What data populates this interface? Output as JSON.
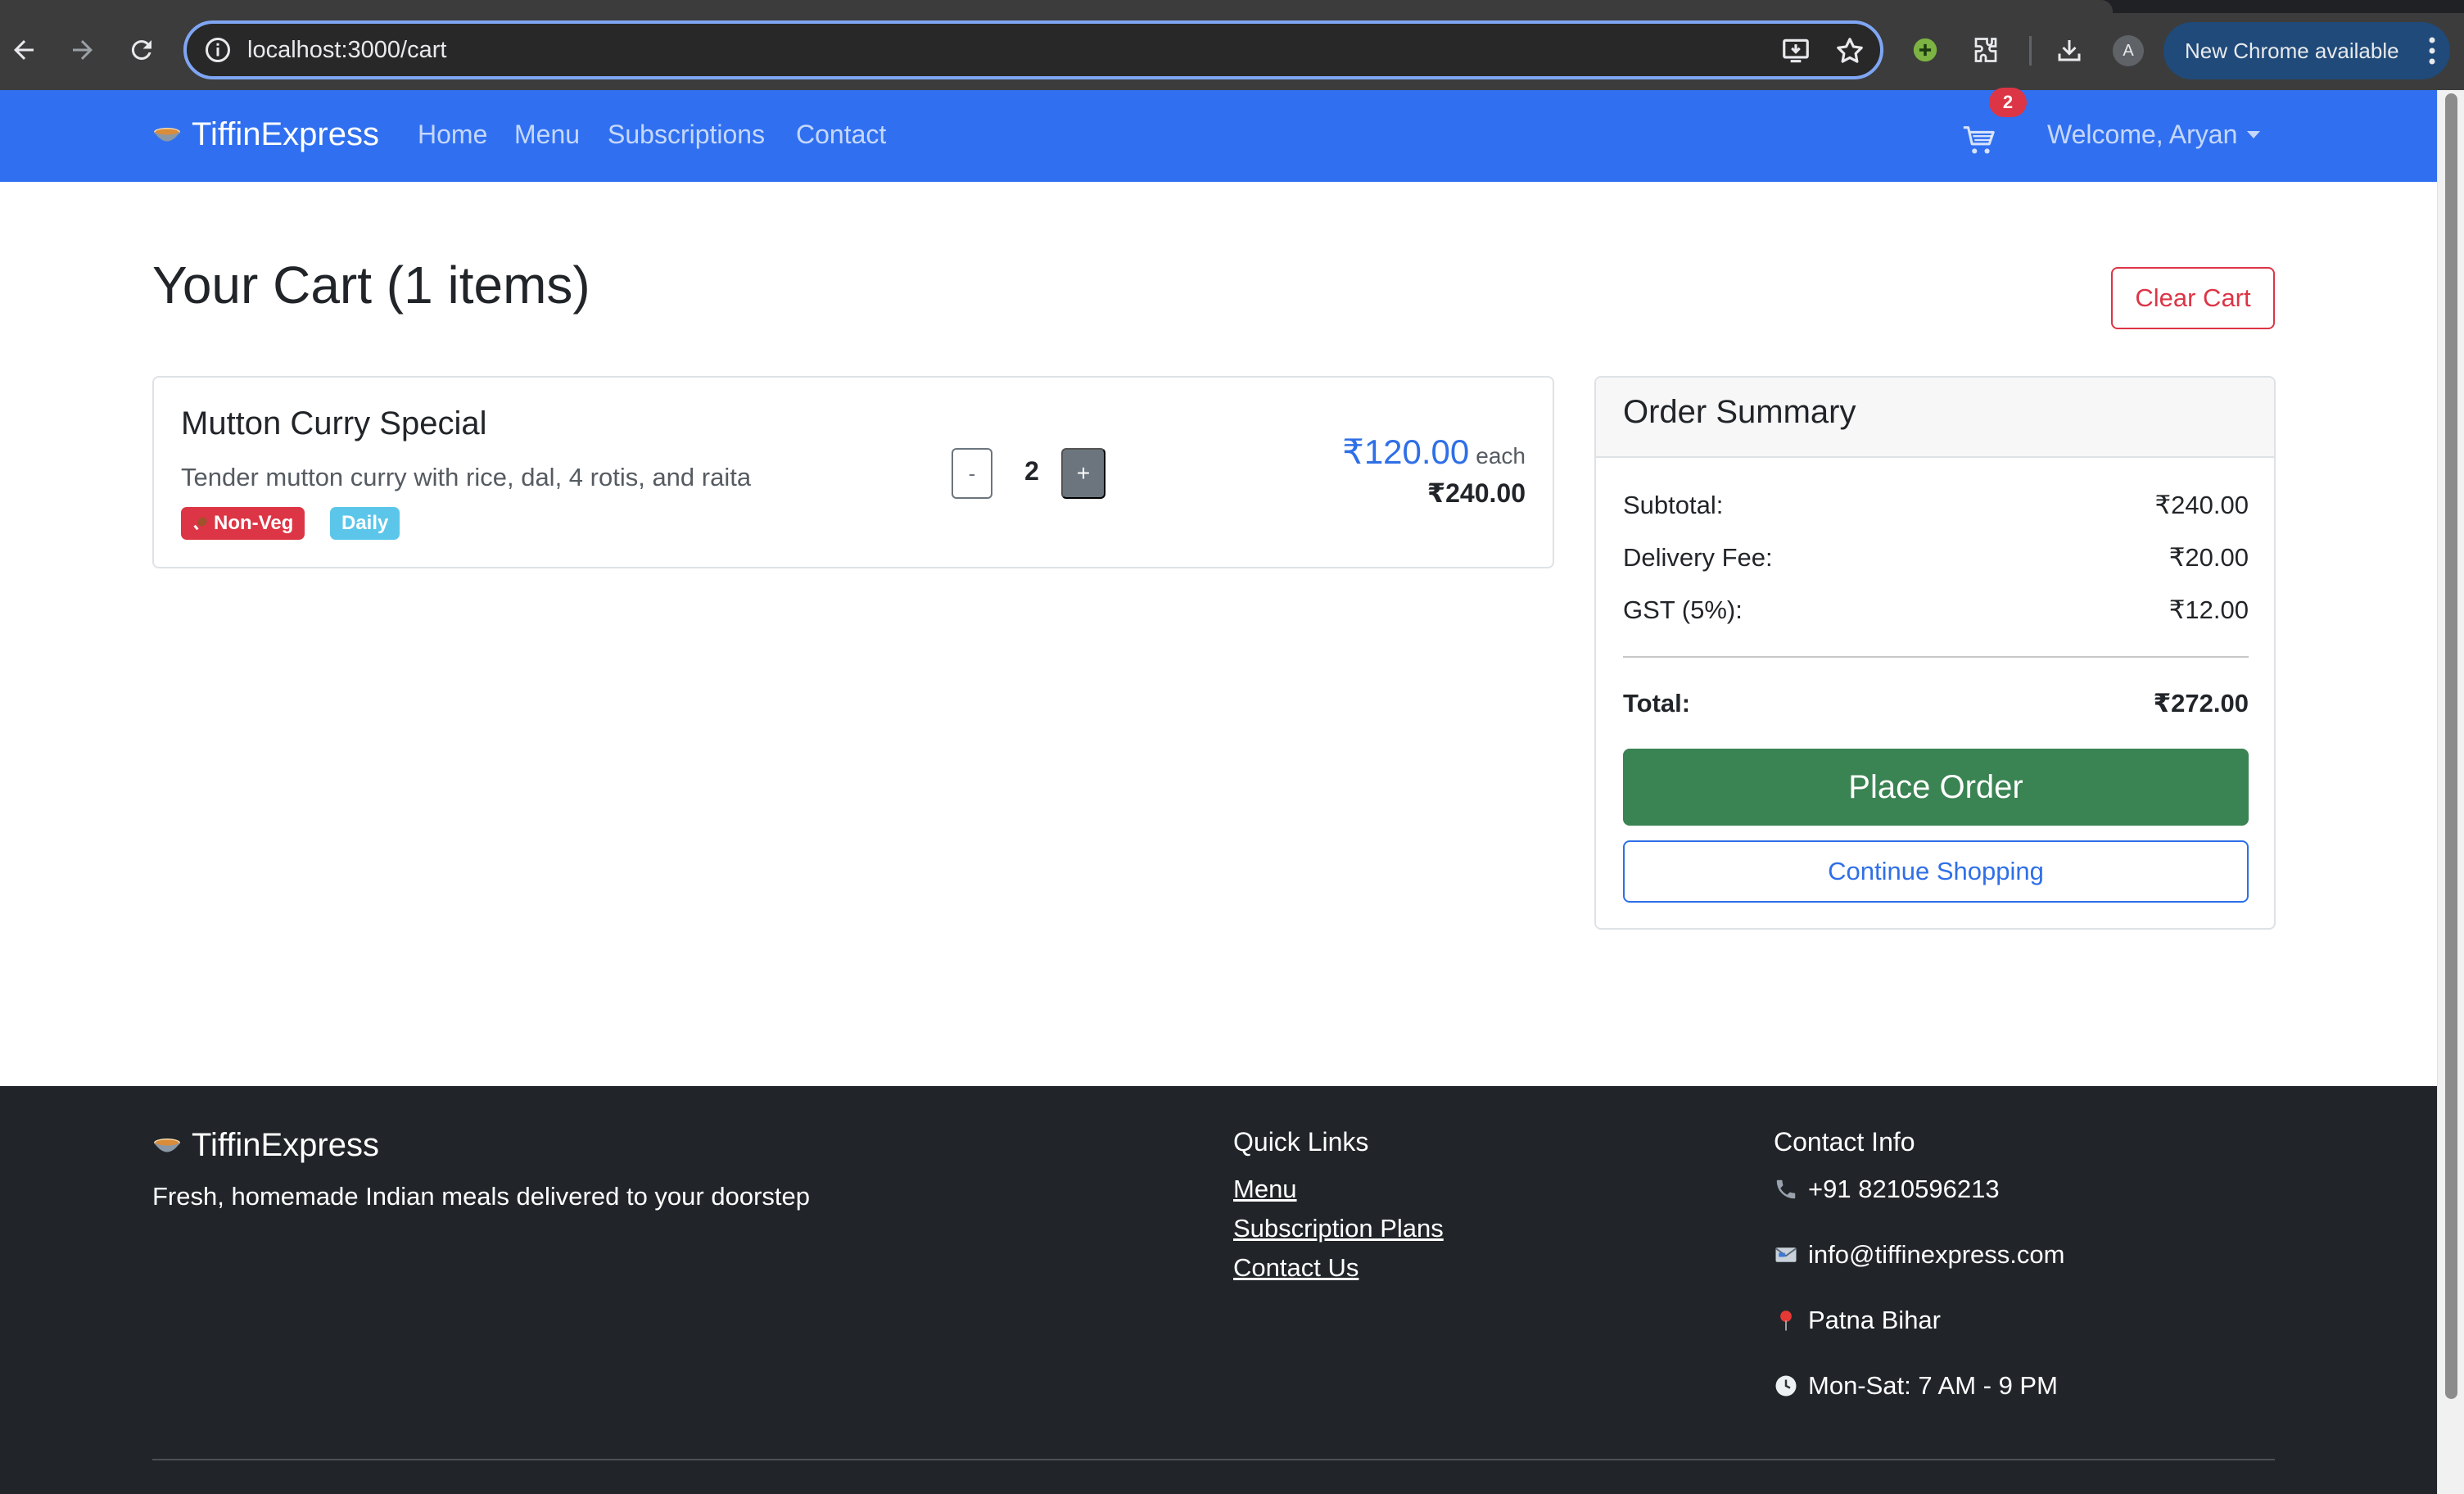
{
  "browser": {
    "url": "localhost:3000/cart",
    "profile_initial": "A",
    "update_label": "New Chrome available",
    "icons": {
      "back": "back-arrow-icon",
      "forward": "forward-arrow-icon",
      "reload": "reload-icon",
      "site_info": "info-icon",
      "install": "install-app-icon",
      "bookmark": "star-icon",
      "extension_green": "green-plus-extension-icon",
      "extensions": "puzzle-icon",
      "downloads": "download-icon",
      "menu": "kebab-menu-icon"
    }
  },
  "navbar": {
    "brand": "TiffinExpress",
    "links": [
      "Home",
      "Menu",
      "Subscriptions",
      "Contact"
    ],
    "cart_count": "2",
    "user_menu": "Welcome, Aryan",
    "background": "#3070f0"
  },
  "cart": {
    "title": "Your Cart (1 items)",
    "clear_label": "Clear Cart",
    "items": [
      {
        "name": "Mutton Curry Special",
        "description": "Tender mutton curry with rice, dal, 4 rotis, and raita",
        "badges": [
          "Non-Veg",
          "Daily"
        ],
        "qty_minus": "-",
        "quantity": "2",
        "qty_plus": "+",
        "unit_price": "₹120.00",
        "unit_suffix": "each",
        "line_total": "₹240.00"
      }
    ]
  },
  "summary": {
    "title": "Order Summary",
    "rows": [
      {
        "label": "Subtotal:",
        "value": "₹240.00"
      },
      {
        "label": "Delivery Fee:",
        "value": "₹20.00"
      },
      {
        "label": "GST (5%):",
        "value": "₹12.00"
      }
    ],
    "total_label": "Total:",
    "total_value": "₹272.00",
    "place_order": "Place Order",
    "continue_shopping": "Continue Shopping",
    "colors": {
      "place_order": "#3a8352",
      "accent": "#2f6fe7",
      "danger": "#dc3545"
    }
  },
  "footer": {
    "brand": "TiffinExpress",
    "tagline": "Fresh, homemade Indian meals delivered to your doorstep",
    "quick_links_title": "Quick Links",
    "quick_links": [
      "Menu",
      "Subscription Plans",
      "Contact Us"
    ],
    "contact_title": "Contact Info",
    "contact": [
      {
        "icon": "phone-icon",
        "text": "+91 8210596213"
      },
      {
        "icon": "envelope-icon",
        "text": "info@tiffinexpress.com"
      },
      {
        "icon": "pin-icon",
        "text": "Patna Bihar"
      },
      {
        "icon": "clock-icon",
        "text": "Mon-Sat: 7 AM - 9 PM"
      }
    ]
  }
}
